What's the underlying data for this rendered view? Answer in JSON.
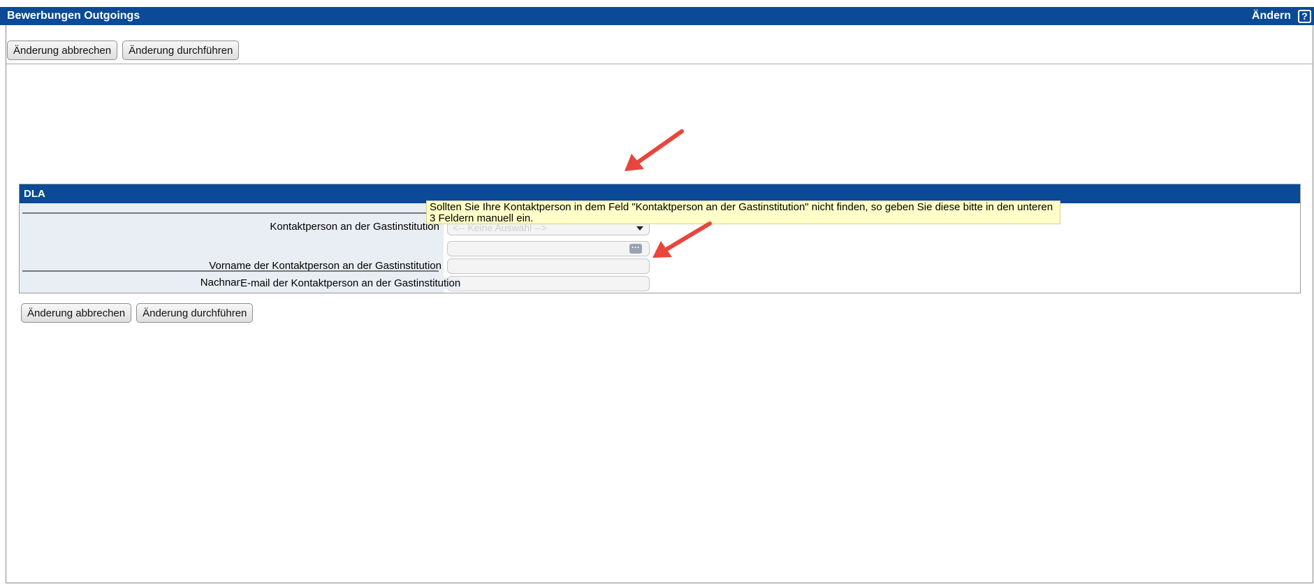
{
  "window": {
    "title": "Bewerbungen Outgoings",
    "mode": "Ändern",
    "help_icon": "?"
  },
  "toolbar": {
    "cancel_label": "Änderung abbrechen",
    "apply_label": "Änderung durchführen"
  },
  "section": {
    "title": "DLA",
    "contact": {
      "label": "Kontaktperson an der Gastinstitution",
      "selected": "<-- Keine Auswahl -->"
    },
    "hint": "Sollten Sie Ihre Kontaktperson in dem Feld \"Kontaktperson an der Gastinstitution\" nicht finden, so geben Sie diese bitte in den unteren 3 Feldern manuell ein.",
    "fields": [
      {
        "label": "Vorname der Kontaktperson an der Gastinstitution",
        "value": ""
      },
      {
        "label": "Nachname der Kontaktperson an der Gastinstitution",
        "value": ""
      },
      {
        "label": "E-mail der Kontaktperson an der Gastinstitution",
        "value": ""
      }
    ]
  },
  "bottom_toolbar": {
    "cancel_label": "Änderung abbrechen",
    "apply_label": "Änderung durchführen"
  },
  "colors": {
    "header": "#0a4a96",
    "label_bg": "#e9edf4",
    "hint_bg": "#ffffc9",
    "annotation_arrow": "#e8453c"
  }
}
